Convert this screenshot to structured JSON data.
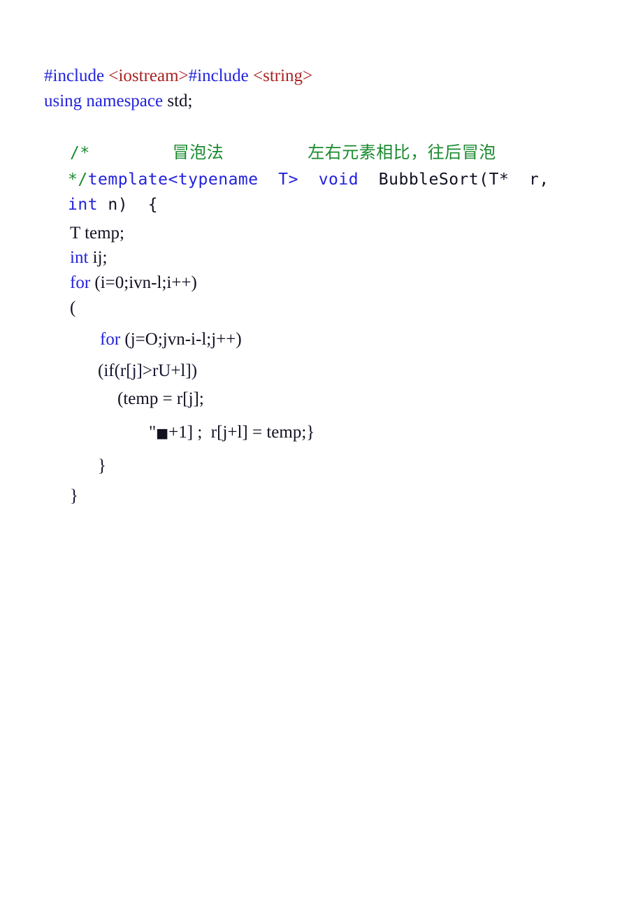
{
  "document": {
    "background_color": "#ffffff",
    "language": "C++",
    "colors": {
      "keyword_blue": "#2222DD",
      "include_red": "#AA2222",
      "comment_green": "#1A8A2E",
      "plain_black": "#111122",
      "dark_navy": "#151530"
    }
  },
  "code": {
    "line1": {
      "include_kw_1": "#include ",
      "header_1": "<iostream>",
      "include_kw_2": "#include ",
      "header_2": "<string>"
    },
    "line2": {
      "using_kw": "using namespace ",
      "plain": "std;"
    },
    "line3_comment": {
      "open": "/*",
      "label_cn": "冒泡法",
      "desc_cn": "左右元素相比，往后冒泡"
    },
    "line4": {
      "close_comment": "*/",
      "keyword": "template<typename  T>  void ",
      "plain": " BubbleSort(T*  r,"
    },
    "line5": {
      "keyword": "int",
      "plain": " n)  {"
    },
    "line6": {
      "plain": "T temp;"
    },
    "line7": {
      "keyword": "int",
      "plain": " ij;"
    },
    "line8": {
      "keyword": "for",
      "plain": " (i=0;ivn-l;i++)"
    },
    "line9": {
      "plain": "("
    },
    "line10": {
      "keyword": "for",
      "plain": " (j=O;jvn-i-l;j++)"
    },
    "line11": {
      "plain": "(if(r[j]>rU+l])"
    },
    "line12": {
      "plain": "(temp = r[j];"
    },
    "line13": {
      "prefix": "\"",
      "glyph": "■",
      "suffix": "+1] ;  r[j+l] = temp;}"
    },
    "line14": {
      "plain": "}"
    },
    "line15": {
      "plain": "}"
    }
  }
}
